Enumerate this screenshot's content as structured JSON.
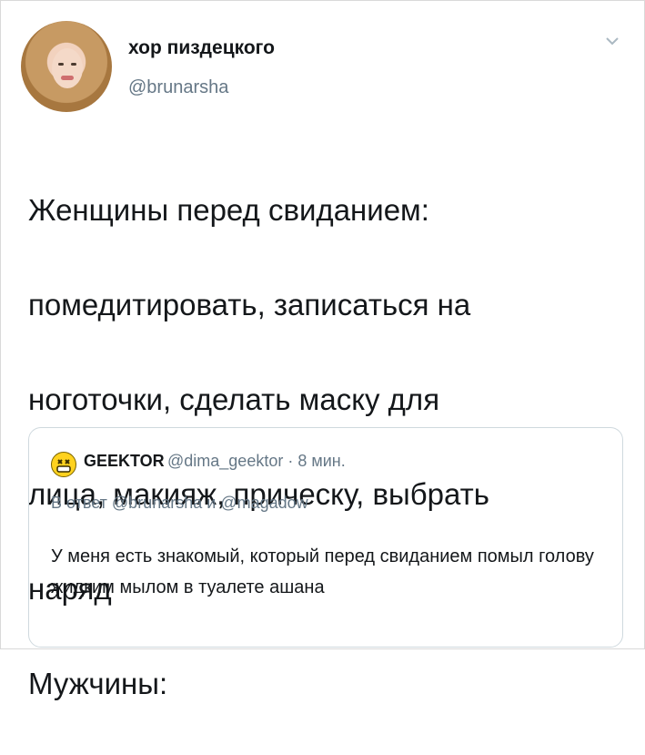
{
  "tweet": {
    "display_name": "хор пиздецкого",
    "handle": "@brunarsha",
    "text_lines": [
      "Женщины перед свиданием:",
      "помедитировать, записаться на",
      "ноготочки, сделать маску для",
      "лица, макияж, прическу, выбрать",
      "наряд",
      "Мужчины:"
    ]
  },
  "quoted": {
    "name": "GEEKTOR",
    "meta": "@dima_geektor · 8 мин.",
    "reply_prefix": "В ответ",
    "reply_mention_1": "@brunarsha",
    "reply_and": "и",
    "reply_mention_2": "@magadow",
    "text": "У меня есть знакомый, который перед свиданием помыл голову жидким мылом в туалете ашана"
  },
  "icons": {
    "menu": "chevron-down-icon",
    "quoted_avatar": "emoji-avatar-icon"
  }
}
